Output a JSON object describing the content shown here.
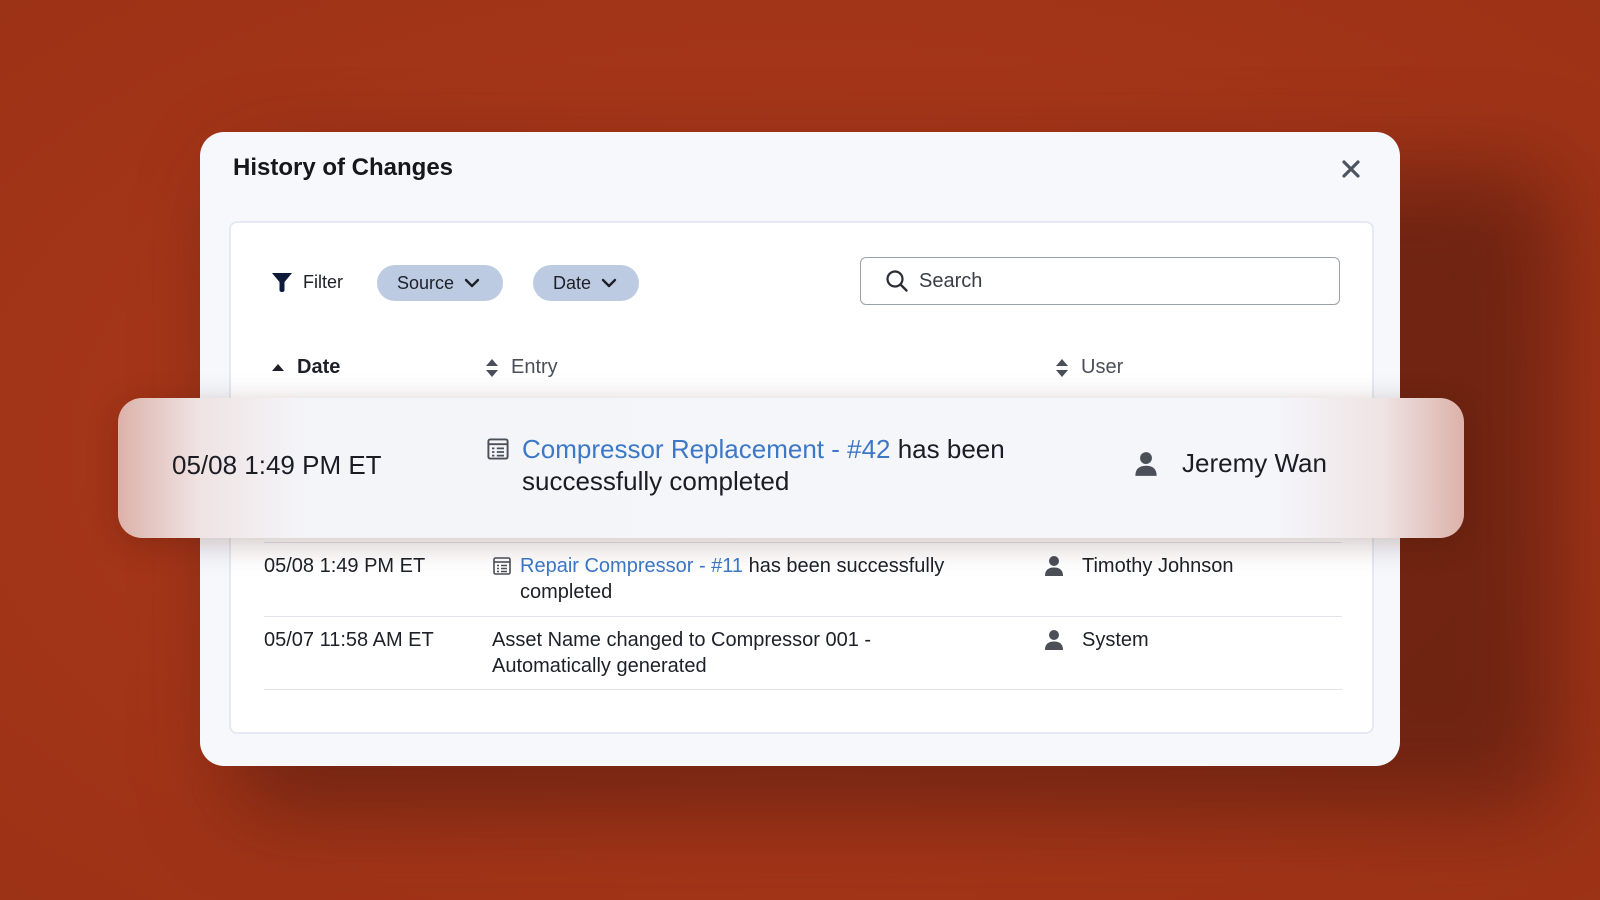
{
  "modal": {
    "title": "History of Changes",
    "close_icon": "close-icon"
  },
  "toolbar": {
    "filter_label": "Filter",
    "filter_icon": "funnel-icon",
    "source_chip": "Source",
    "date_chip": "Date",
    "search_placeholder": "Search",
    "search_icon": "search-icon"
  },
  "table": {
    "columns": [
      {
        "label": "Date",
        "sort": "ascending",
        "active": true
      },
      {
        "label": "Entry",
        "sort": "none",
        "active": false
      },
      {
        "label": "User",
        "sort": "none",
        "active": false
      }
    ],
    "rows": [
      {
        "date": "05/08 1:49 PM ET",
        "entry_icon": "work-order-icon",
        "entry_link": "Compressor Replacement - #42",
        "entry_text": " has been successfully completed",
        "user": "Jeremy Wan",
        "highlighted": true
      },
      {
        "date": "05/08 1:49 PM ET",
        "entry_icon": "work-order-icon",
        "entry_link": "Repair Compressor - #11",
        "entry_text": " has been successfully completed",
        "user": "Timothy Johnson"
      },
      {
        "date": "05/07 11:58 AM ET",
        "entry_text": "Asset Name changed to Compressor 001 - Automatically generated",
        "user": "System"
      }
    ]
  },
  "colors": {
    "background": "#a63718",
    "link": "#3c78c6",
    "chip": "#bdcbe2"
  }
}
